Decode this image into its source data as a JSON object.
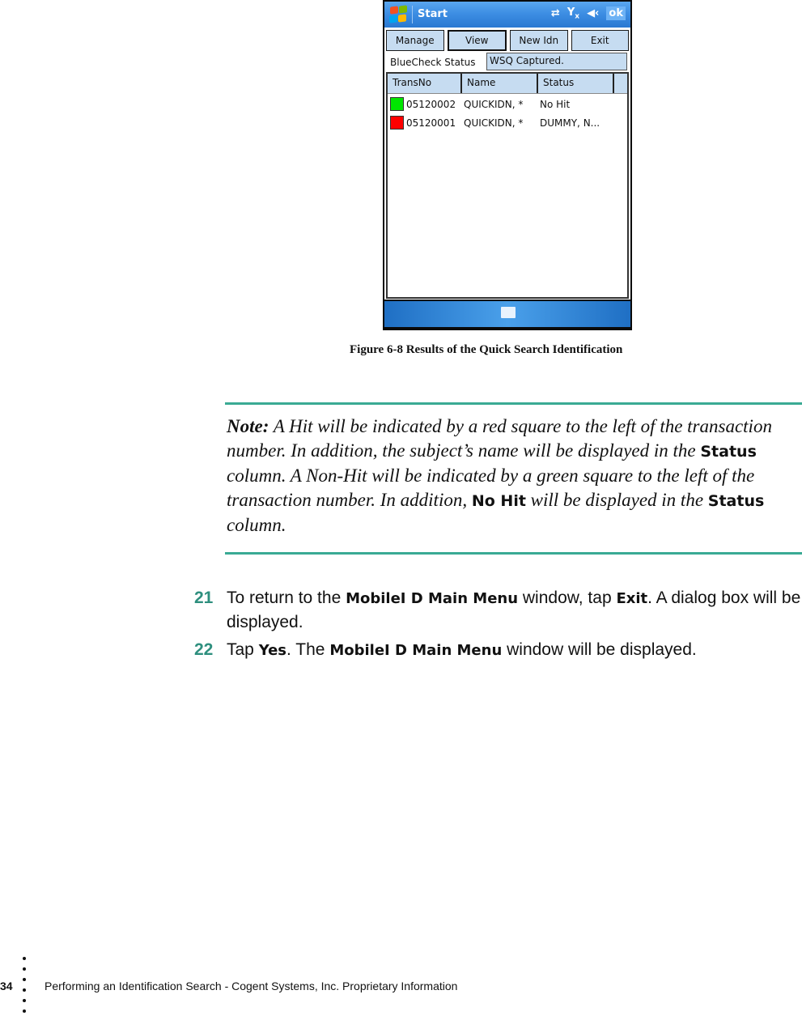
{
  "device": {
    "titlebar": {
      "start_label": "Start",
      "ok_label": "ok",
      "icons": [
        "windows-logo-icon",
        "connectivity-icon",
        "signal-off-icon",
        "speaker-icon"
      ]
    },
    "buttons": [
      {
        "label": "Manage",
        "selected": false
      },
      {
        "label": "View",
        "selected": true
      },
      {
        "label": "New Idn",
        "selected": false
      },
      {
        "label": "Exit",
        "selected": false
      }
    ],
    "status": {
      "label": "BlueCheck Status",
      "value": "WSQ Captured."
    },
    "list": {
      "columns": [
        "TransNo",
        "Name",
        "Status"
      ],
      "rows": [
        {
          "indicator_color": "#00e600",
          "trans_no": "05120002",
          "name": "QUICKIDN, *",
          "status": "No Hit"
        },
        {
          "indicator_color": "#ff0000",
          "trans_no": "05120001",
          "name": "QUICKIDN, *",
          "status": "DUMMY, N..."
        }
      ]
    },
    "bottombar": {
      "icon": "keyboard-icon"
    }
  },
  "caption": "Figure 6-8 Results of the Quick Search Identification",
  "note": {
    "label": "Note:",
    "part1": " A Hit will be indicated by a red square to the left of the transaction number. In addition, the subject’s name will be displayed in the ",
    "ui1": "Status",
    "part2": " column. A Non-Hit will be indicated by a green square to the left of the transaction number. In addition, ",
    "ui2": "No Hit",
    "part3": " will be displayed in the ",
    "ui3": "Status",
    "part4": " column."
  },
  "steps": [
    {
      "number": "21",
      "t1": "To return to the ",
      "b1": "MobileI D Main Menu",
      "t2": " window, tap ",
      "b2": "Exit",
      "t3": ". A dialog box will be displayed."
    },
    {
      "number": "22",
      "t1": "Tap ",
      "b1": "Yes",
      "t2": ". The ",
      "b2": "MobileI D Main Menu",
      "t3": " window will be displayed."
    }
  ],
  "footer": {
    "page_number": "34",
    "text": "Performing an Identification Search  - Cogent Systems, Inc. Proprietary Information"
  },
  "colors": {
    "accent": "#3aaa94",
    "step_number": "#2e8f7e"
  }
}
